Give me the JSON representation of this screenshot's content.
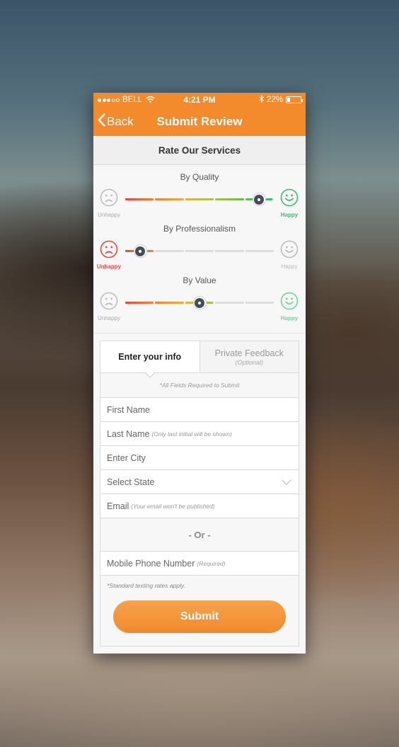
{
  "status_bar": {
    "carrier": "BELL",
    "time": "4:21 PM",
    "battery": "22%",
    "battery_level": 0.22
  },
  "nav": {
    "back_label": "Back",
    "title": "Submit Review"
  },
  "section_title": "Rate Our Services",
  "ratings": [
    {
      "label": "By Quality",
      "unhappy_label": "Unhappy",
      "happy_label": "Happy",
      "value": 0.9,
      "mood": "happy"
    },
    {
      "label": "By Professionalism",
      "unhappy_label": "Unhappy",
      "happy_label": "Happy",
      "value": 0.1,
      "mood": "unhappy"
    },
    {
      "label": "By Value",
      "unhappy_label": "Unhappy",
      "happy_label": "Happy",
      "value": 0.5,
      "mood": "happy-soft"
    }
  ],
  "colors": {
    "accent": "#f38a2b",
    "happy": "#3cba6a",
    "unhappy": "#e8473a",
    "neutral": "#bdbdbd",
    "track_gray": "#dcdcdc"
  },
  "tabs": {
    "active": "Enter your info",
    "inactive": "Private Feedback",
    "inactive_sub": "(Optional)"
  },
  "form": {
    "required_note": "*All Fields Required to Submit",
    "first_name": "First Name",
    "last_name": "Last Name",
    "last_name_hint": "(Only last initial will be shown)",
    "city": "Enter City",
    "state": "Select State",
    "email": "Email",
    "email_hint": "(Your email won't be published)",
    "or_label": "- Or -",
    "phone": "Mobile Phone Number",
    "phone_hint": "(Required)",
    "rates_note": "*Standard texting rates apply.",
    "submit_label": "Submit"
  },
  "icons": {
    "back": "chevron-left-icon",
    "wifi": "wifi-icon",
    "bluetooth": "bluetooth-icon",
    "battery": "battery-icon",
    "sad": "sad-face-icon",
    "smile": "smile-face-icon",
    "dropdown": "chevron-down-icon"
  }
}
